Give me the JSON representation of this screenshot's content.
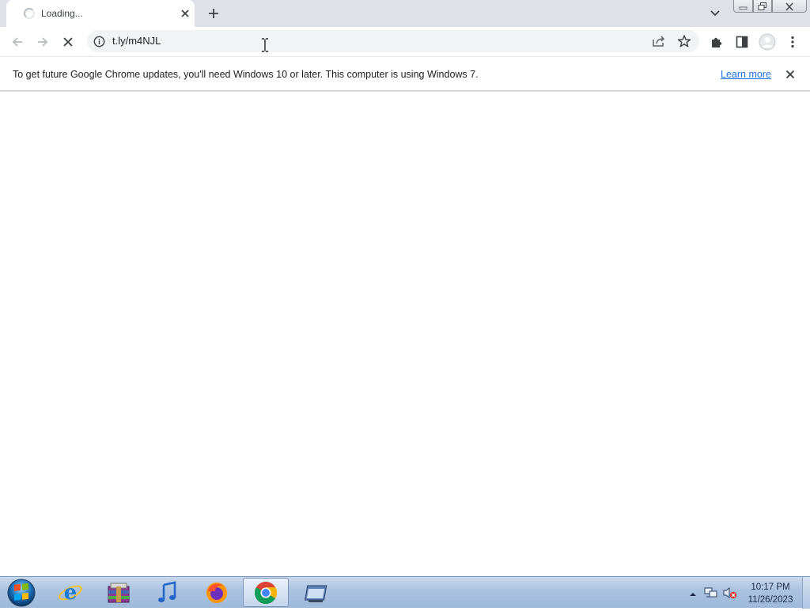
{
  "tab": {
    "title": "Loading...",
    "spinner_icon": "loading-spinner-icon",
    "close_icon": "close-icon"
  },
  "tabstrip": {
    "new_tab_icon": "plus-icon",
    "tab_search_icon": "chevron-down-icon"
  },
  "window_controls": {
    "minimize_icon": "minimize-icon",
    "restore_icon": "restore-icon",
    "close_icon": "close-icon"
  },
  "toolbar": {
    "back_icon": "back-arrow-icon",
    "forward_icon": "forward-arrow-icon",
    "stop_icon": "stop-x-icon",
    "url": "t.ly/m4NJL",
    "site_info_icon": "info-icon",
    "share_icon": "share-icon",
    "bookmark_icon": "star-icon",
    "extensions_icon": "puzzle-icon",
    "side_panel_icon": "side-panel-icon",
    "profile_icon": "profile-avatar-icon",
    "menu_icon": "kebab-menu-icon"
  },
  "infobar": {
    "message": "To get future Google Chrome updates, you'll need Windows 10 or later. This computer is using Windows 7.",
    "link_label": "Learn more",
    "close_icon": "close-icon"
  },
  "taskbar": {
    "apps": [
      "internet-explorer-icon",
      "archive-icon",
      "music-note-icon",
      "firefox-icon",
      "chrome-icon",
      "window-app-icon"
    ],
    "active_app": "chrome-icon",
    "clock_time": "10:17 PM",
    "clock_date": "11/26/2023"
  },
  "colors": {
    "tabstrip_bg": "#dee1e6",
    "omnibox_bg": "#f1f3f4",
    "link": "#1a73e8",
    "taskbar_bg": "#a9c2e0"
  }
}
